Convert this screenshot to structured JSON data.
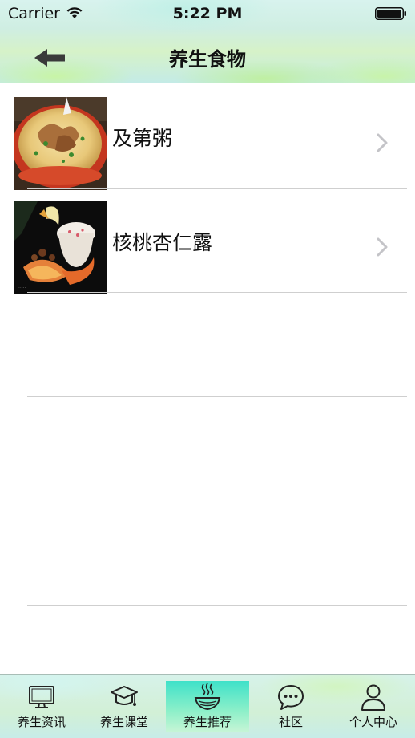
{
  "status_bar": {
    "carrier": "Carrier",
    "time": "5:22 PM",
    "wifi_icon": "wifi-icon",
    "battery_icon": "battery-icon"
  },
  "nav": {
    "title": "养生食物",
    "back_icon": "back-arrow-icon"
  },
  "list": {
    "items": [
      {
        "title": "及第粥",
        "image": "porridge-photo"
      },
      {
        "title": "核桃杏仁露",
        "image": "almond-drink-photo"
      }
    ]
  },
  "tabbar": {
    "active_index": 2,
    "active_color": "#3fe1c9",
    "tabs": [
      {
        "label": "养生资讯",
        "icon": "monitor-icon"
      },
      {
        "label": "养生课堂",
        "icon": "graduation-cap-icon"
      },
      {
        "label": "养生推荐",
        "icon": "noodle-bowl-icon"
      },
      {
        "label": "社区",
        "icon": "chat-bubble-icon"
      },
      {
        "label": "个人中心",
        "icon": "person-icon"
      }
    ]
  }
}
